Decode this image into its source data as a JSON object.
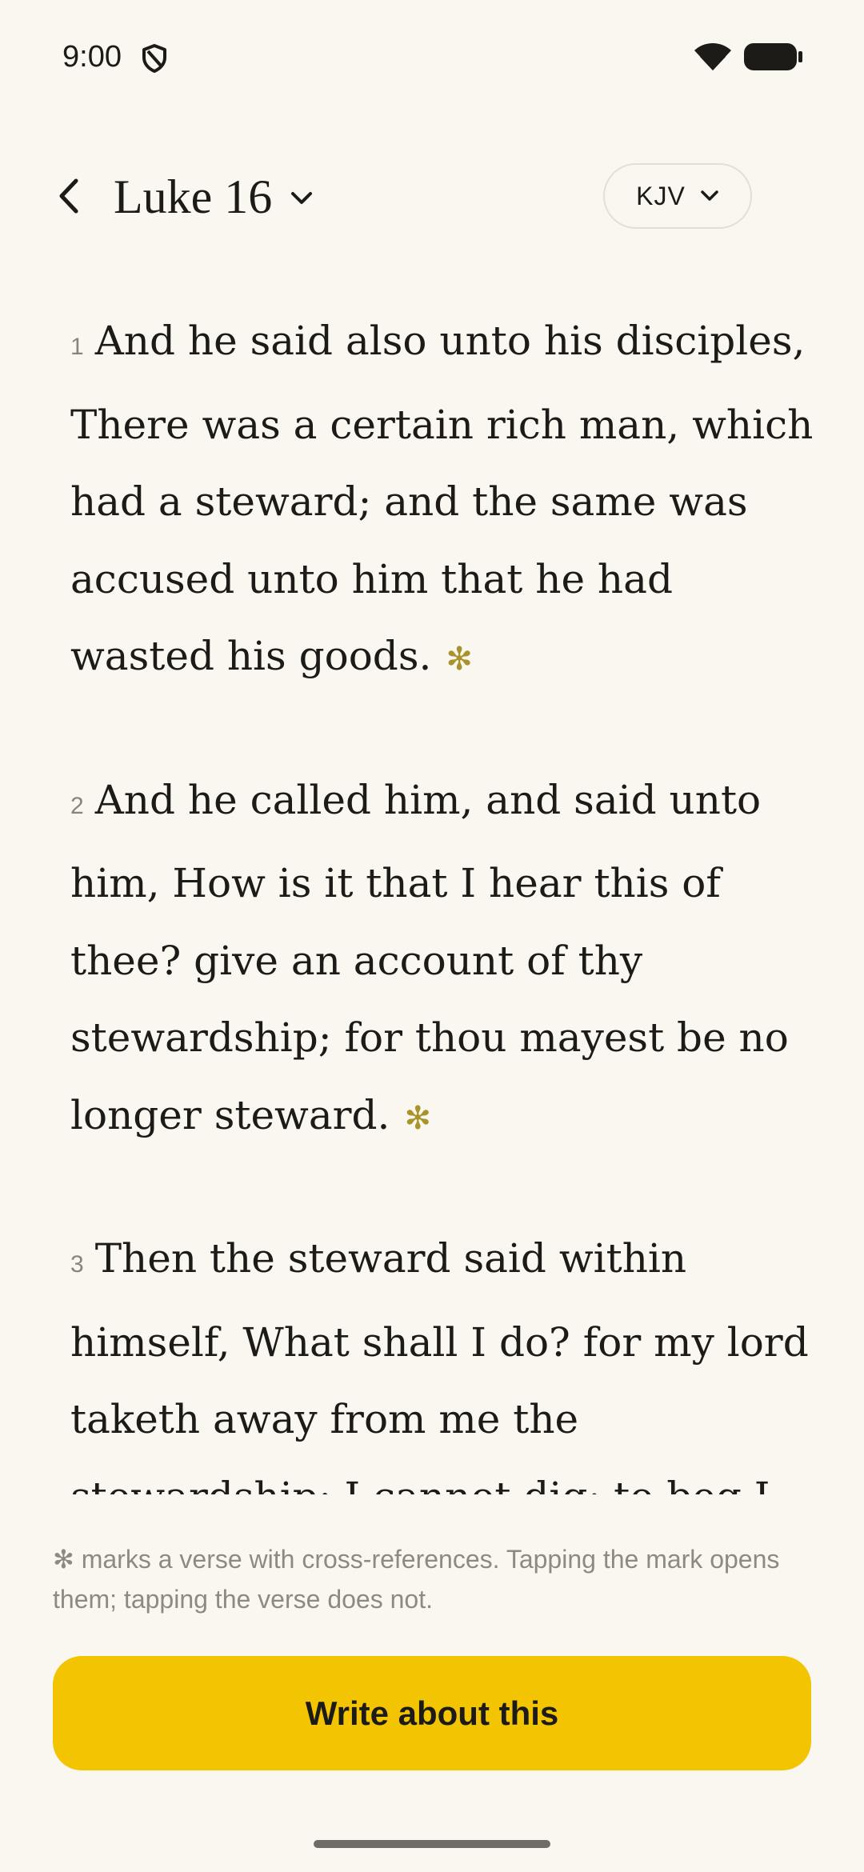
{
  "status_bar": {
    "time": "9:00",
    "icons": [
      "shield-icon",
      "wifi-icon",
      "battery-icon"
    ]
  },
  "header": {
    "back_icon": "chevron-left-icon",
    "chapter_title": "Luke 16",
    "chapter_dropdown_icon": "chevron-down-icon",
    "version_label": "KJV",
    "version_dropdown_icon": "chevron-down-icon"
  },
  "verses": [
    {
      "number": "1",
      "text": "And he said also unto his disciples, There was a certain rich man, which had a steward; and the same was accused unto him that he had wasted his goods.",
      "crossref_mark": "✻"
    },
    {
      "number": "2",
      "text": "And he called him, and said unto him, How is it that I hear this of thee? give an account of thy stewardship; for thou mayest be no longer steward.",
      "crossref_mark": "✻"
    },
    {
      "number": "3",
      "text": "Then the steward said within himself, What shall I do? for my lord taketh away from me the stewardship: I cannot dig; to beg I"
    }
  ],
  "footnote": "✻ marks a verse with cross-references. Tapping the mark opens them; tapping the verse does not.",
  "primary_action": {
    "label": "Write about this"
  },
  "colors": {
    "background": "#faf7f1",
    "accent_button": "#f2c402",
    "crossref_mark": "#a8942a",
    "text": "#1d1b18",
    "muted_text": "#8e8a82"
  }
}
